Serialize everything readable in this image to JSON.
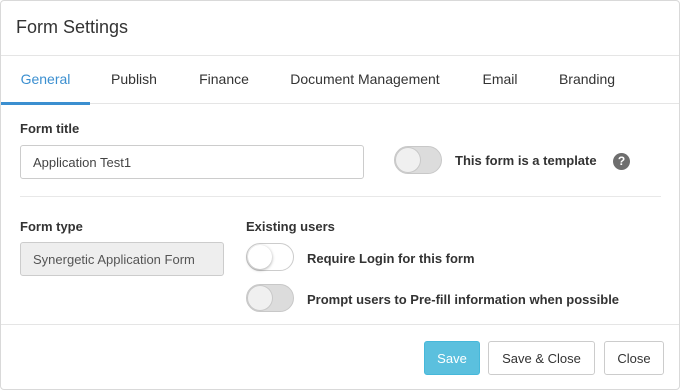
{
  "dialog": {
    "title": "Form Settings"
  },
  "tabs": [
    {
      "label": "General",
      "active": true
    },
    {
      "label": "Publish"
    },
    {
      "label": "Finance"
    },
    {
      "label": "Document Management"
    },
    {
      "label": "Email"
    },
    {
      "label": "Branding"
    }
  ],
  "general": {
    "form_title_label": "Form title",
    "form_title_value": "Application Test1",
    "template_toggle_label": "This form is a template",
    "template_toggle_on": false,
    "help_glyph": "?",
    "form_type_label": "Form type",
    "form_type_value": "Synergetic Application Form",
    "existing_users_label": "Existing users",
    "require_login_label": "Require Login for this form",
    "require_login_on": false,
    "prefill_label": "Prompt users to Pre-fill information when possible",
    "prefill_on": false
  },
  "footer": {
    "save_label": "Save",
    "save_close_label": "Save & Close",
    "close_label": "Close"
  },
  "colors": {
    "accent": "#3b8fd0",
    "primary_button": "#5bc0de"
  }
}
